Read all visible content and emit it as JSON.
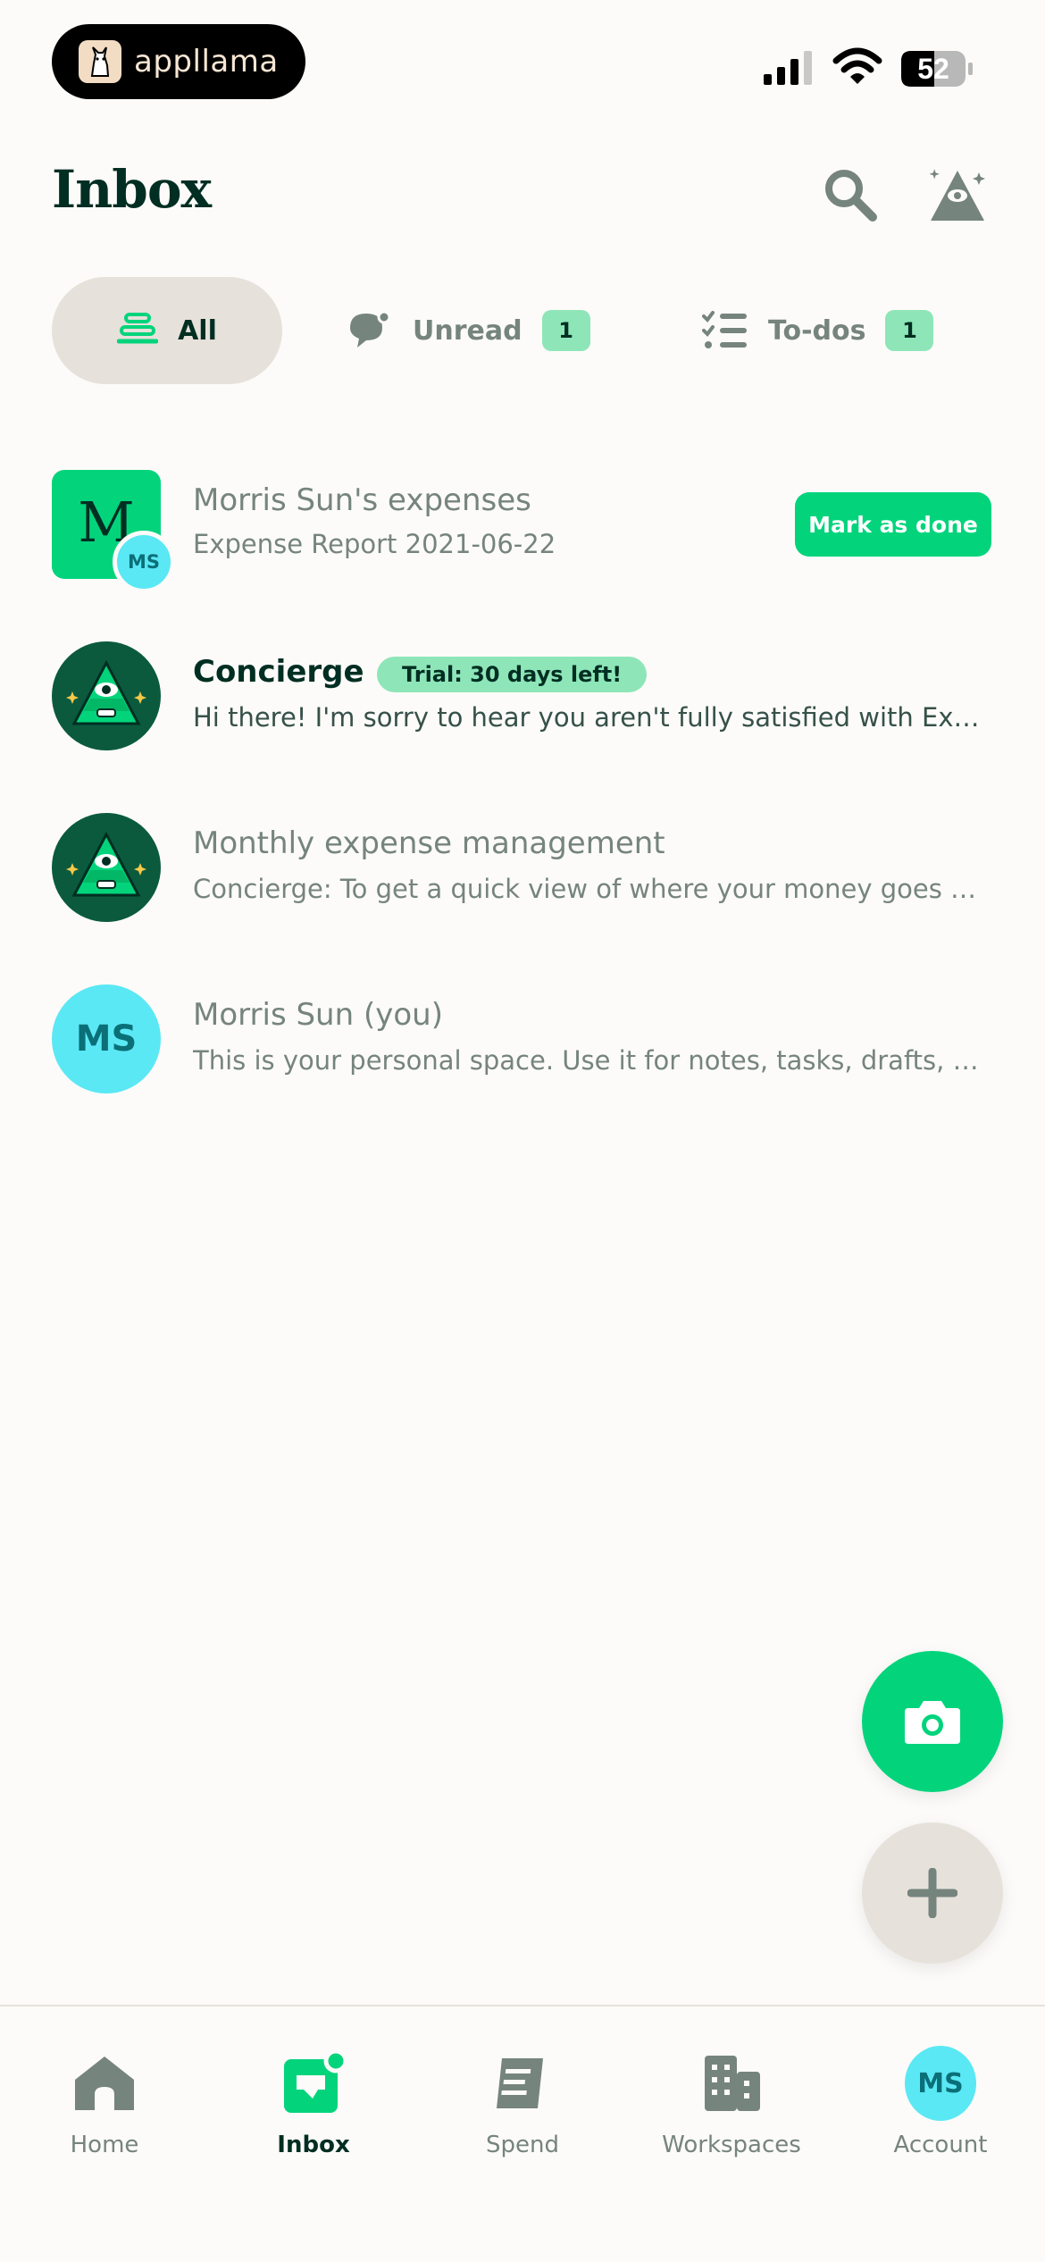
{
  "status_bar": {
    "brand_name": "appllama",
    "battery_level": "52"
  },
  "header": {
    "title": "Inbox"
  },
  "tabs": [
    {
      "label": "All",
      "active": true
    },
    {
      "label": "Unread",
      "count": "1"
    },
    {
      "label": "To-dos",
      "count": "1"
    }
  ],
  "rows": [
    {
      "avatar_letter": "M",
      "avatar_badge": "MS",
      "title": "Morris Sun's expenses",
      "subtitle": "Expense Report 2021-06-22",
      "action_label": "Mark as done"
    },
    {
      "title": "Concierge",
      "tag": "Trial: 30 days left!",
      "subtitle": "Hi there! I'm sorry to hear you aren't fully satisfied with Expen..."
    },
    {
      "title": "Monthly expense management",
      "subtitle": "Concierge: To get a quick view of where your money goes eac..."
    },
    {
      "avatar_initials": "MS",
      "title": "Morris Sun (you)",
      "subtitle": "This is your personal space. Use it for notes, tasks, drafts, and..."
    }
  ],
  "bottom_nav": [
    {
      "label": "Home",
      "icon": "home-icon"
    },
    {
      "label": "Inbox",
      "icon": "inbox-icon",
      "active": true
    },
    {
      "label": "Spend",
      "icon": "receipt-icon"
    },
    {
      "label": "Workspaces",
      "icon": "building-icon"
    },
    {
      "label": "Account",
      "icon": "avatar",
      "initials": "MS"
    }
  ],
  "colors": {
    "accent_green": "#03d47c",
    "dark_green": "#002e22",
    "badge_green": "#8ee6b8",
    "avatar_cyan": "#5ae8f4",
    "muted_text": "#76847e",
    "pill_bg": "#e6e1da"
  }
}
